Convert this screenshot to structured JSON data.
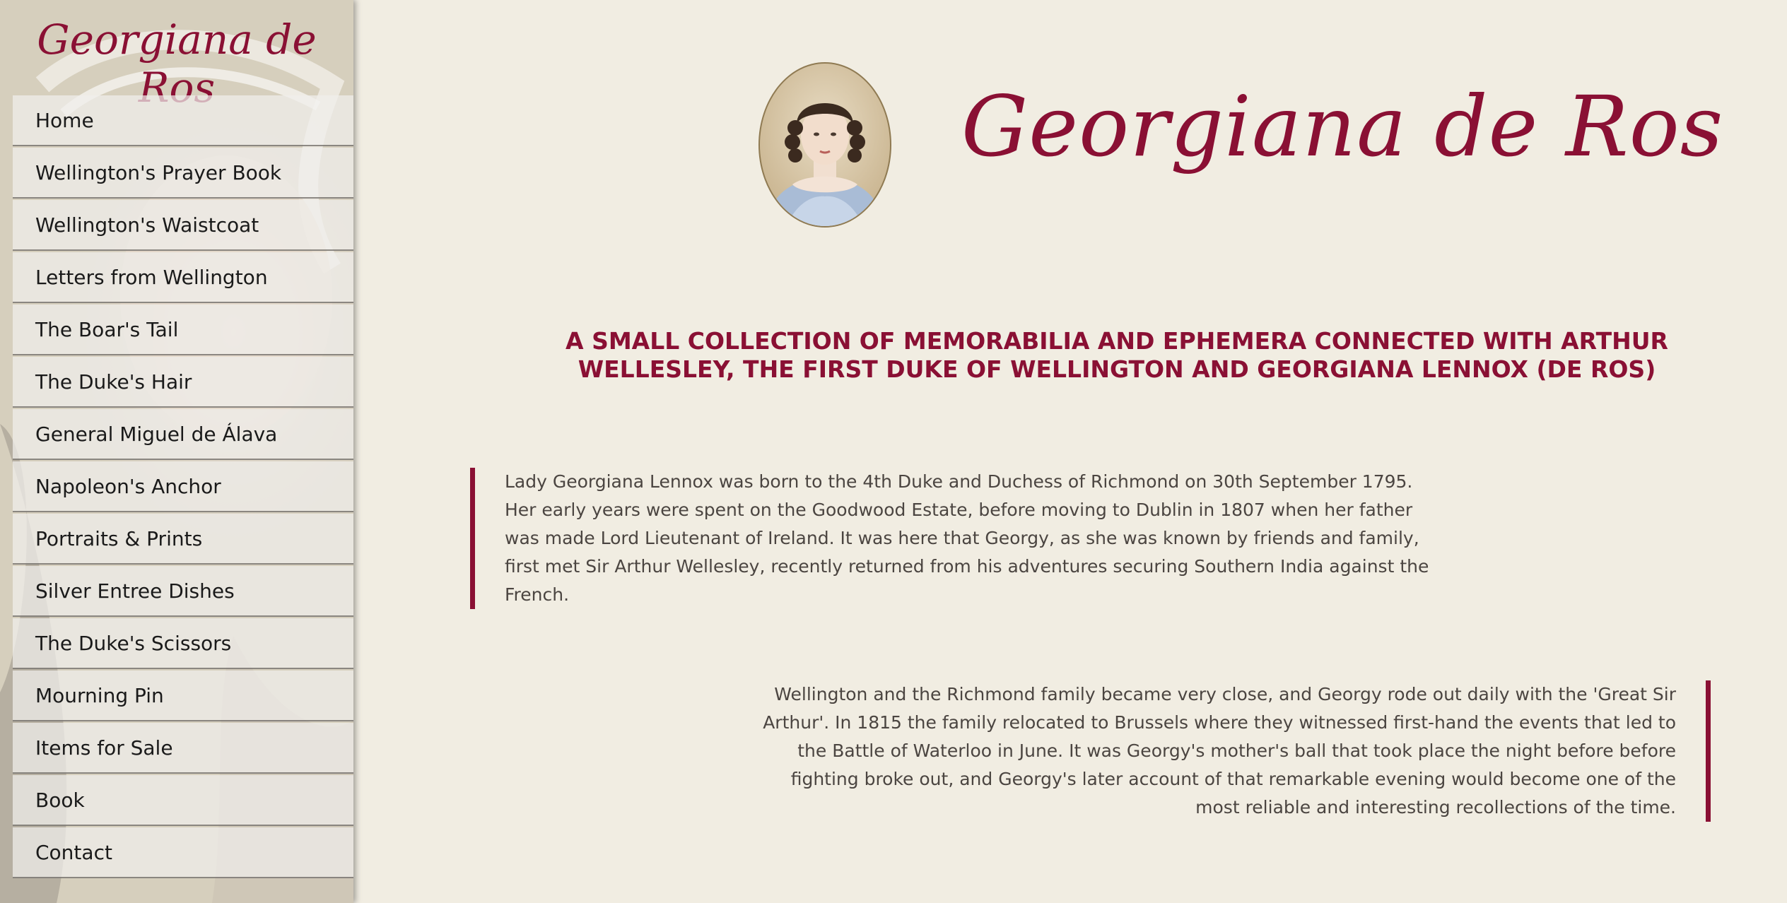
{
  "sidebar": {
    "title": "Georgiana de Ros",
    "items": [
      {
        "label": "Home"
      },
      {
        "label": "Wellington's Prayer Book"
      },
      {
        "label": "Wellington's Waistcoat"
      },
      {
        "label": "Letters from Wellington"
      },
      {
        "label": "The Boar's Tail"
      },
      {
        "label": "The Duke's Hair"
      },
      {
        "label": "General Miguel de Álava"
      },
      {
        "label": "Napoleon's Anchor"
      },
      {
        "label": "Portraits & Prints"
      },
      {
        "label": "Silver Entree Dishes"
      },
      {
        "label": "The Duke's Scissors"
      },
      {
        "label": "Mourning Pin"
      },
      {
        "label": "Items for Sale"
      },
      {
        "label": "Book"
      },
      {
        "label": "Contact"
      }
    ]
  },
  "header": {
    "title": "Georgiana de Ros",
    "subtitle": "A SMALL COLLECTION OF MEMORABILIA AND EPHEMERA CONNECTED WITH ARTHUR WELLESLEY, THE FIRST DUKE OF WELLINGTON AND GEORGIANA LENNOX (DE ROS)"
  },
  "main": {
    "paragraph_1": "Lady Georgiana Lennox was born to the 4th Duke and Duchess of Richmond on 30th September 1795. Her early years were spent on the Goodwood Estate, before moving to Dublin in 1807 when her father was made Lord Lieutenant of Ireland. It was here that Georgy, as she was known by friends and family, first met Sir Arthur Wellesley, recently returned from his adventures securing Southern India against the French.",
    "paragraph_2": "Wellington and the Richmond family became very close, and Georgy rode out daily with the 'Great Sir Arthur'. In 1815 the family relocated to Brussels where they witnessed first-hand the events that led to the Battle of Waterloo in June. It was Georgy's mother's ball that took place the night before before fighting broke out, and Georgy's later account of that remarkable evening would become one of the most reliable and interesting recollections of the time."
  },
  "colors": {
    "accent": "#8a1034",
    "page_background": "#f1ede2",
    "body_text": "#4b4541"
  }
}
